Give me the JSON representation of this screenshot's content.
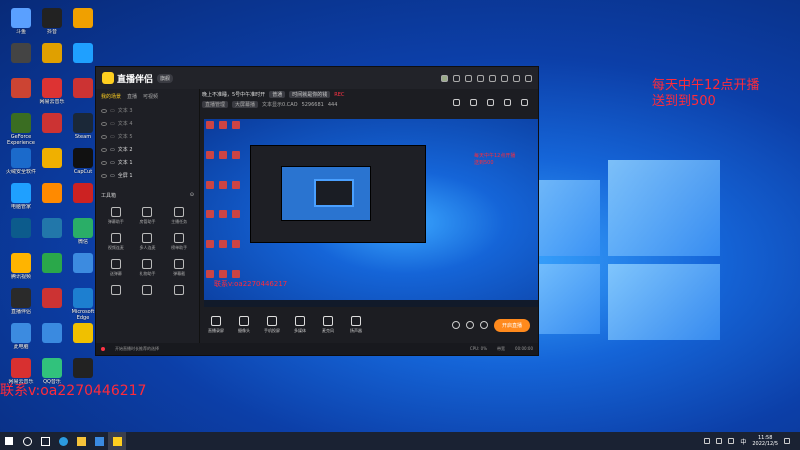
{
  "desktop": {
    "icons": [
      {
        "label": "斗鱼",
        "color": "#5aa0ff"
      },
      {
        "label": "",
        "color": "#444"
      },
      {
        "label": "",
        "color": "#cc4433"
      },
      {
        "label": "GeForce Experience",
        "color": "#3a6d22"
      },
      {
        "label": "火绒安全软件",
        "color": "#1b6acb"
      },
      {
        "label": "电脑管家",
        "color": "#1fa0ff"
      },
      {
        "label": "",
        "color": "#0c5b8c"
      },
      {
        "label": "腾讯视频",
        "color": "#ffb400"
      },
      {
        "label": "直播伴侣",
        "color": "#2a2a2a"
      },
      {
        "label": "此电脑",
        "color": "#3c8be0"
      },
      {
        "label": "网易云音乐",
        "color": "#d83030"
      },
      {
        "label": "抖音",
        "color": "#222"
      },
      {
        "label": "",
        "color": "#e0a000"
      },
      {
        "label": "网易云音乐",
        "color": "#d33"
      },
      {
        "label": "",
        "color": "#c33"
      },
      {
        "label": "",
        "color": "#f0b000"
      },
      {
        "label": "",
        "color": "#ff8a00"
      },
      {
        "label": "",
        "color": "#27a"
      },
      {
        "label": "",
        "color": "#2aa84a"
      },
      {
        "label": "",
        "color": "#c33"
      },
      {
        "label": "",
        "color": "#3a8ae0"
      },
      {
        "label": "QQ音乐",
        "color": "#31c27c"
      },
      {
        "label": "",
        "color": "#f0a000"
      },
      {
        "label": "",
        "color": "#1fa0ff"
      },
      {
        "label": "",
        "color": "#c33"
      },
      {
        "label": "Steam",
        "color": "#1b2838"
      },
      {
        "label": "CapCut",
        "color": "#111"
      },
      {
        "label": "",
        "color": "#c22"
      },
      {
        "label": "微信",
        "color": "#2aae67"
      },
      {
        "label": "",
        "color": "#3c8be0"
      },
      {
        "label": "Microsoft Edge",
        "color": "#1d7fd0"
      },
      {
        "label": "",
        "color": "#f0c000"
      },
      {
        "label": "",
        "color": "#222"
      }
    ],
    "overlay_text": [
      "每天中午12点开播",
      "送到到500"
    ],
    "contact_text": "联系v:oa2270446217"
  },
  "app": {
    "name": "直播伴侣",
    "version": "旗舰",
    "left_tabs": [
      "我的场景",
      "直播",
      "可视频"
    ],
    "scenes": [
      {
        "label": "文本 3",
        "lit": false
      },
      {
        "label": "文本 4",
        "lit": false
      },
      {
        "label": "文本 5",
        "lit": false
      },
      {
        "label": "文本 2",
        "lit": true
      },
      {
        "label": "文本 1",
        "lit": true
      },
      {
        "label": "全屏 1",
        "lit": true
      }
    ],
    "tools_title": "工具箱",
    "tools": [
      "弹幕助手",
      "房管助手",
      "主播任务",
      "视频连麦",
      "多人连麦",
      "榜单助手",
      "送弹幕",
      "礼物助手",
      "弹幕截",
      "",
      "",
      ""
    ],
    "stream": {
      "title": "晚上不准睡，5号中午准时开",
      "tag": "普通",
      "category": "时间就是你的钱",
      "rec": "REC",
      "row2_tag1": "直播管理",
      "row2_tag2": "大屏幕播",
      "row2_text": "文本显示0.CAO",
      "viewers": "5296681",
      "likes": "444"
    },
    "toolbar": [
      "直播录屏",
      "摄像头",
      "手机投屏",
      "多媒体",
      "麦克风",
      "扬声器"
    ],
    "start_button": "开启直播",
    "status": {
      "message": "开始直播时长推荐的选择",
      "cpu": "CPU: 0%",
      "net": "带宽",
      "time": "00:00:00"
    },
    "preview": {
      "red_text": [
        "每天中午12点开播",
        "送到500"
      ],
      "contact": "联系v:oa2270446217"
    }
  },
  "taskbar": {
    "time": "11:58",
    "date": "2022/12/5",
    "lang": "中"
  }
}
